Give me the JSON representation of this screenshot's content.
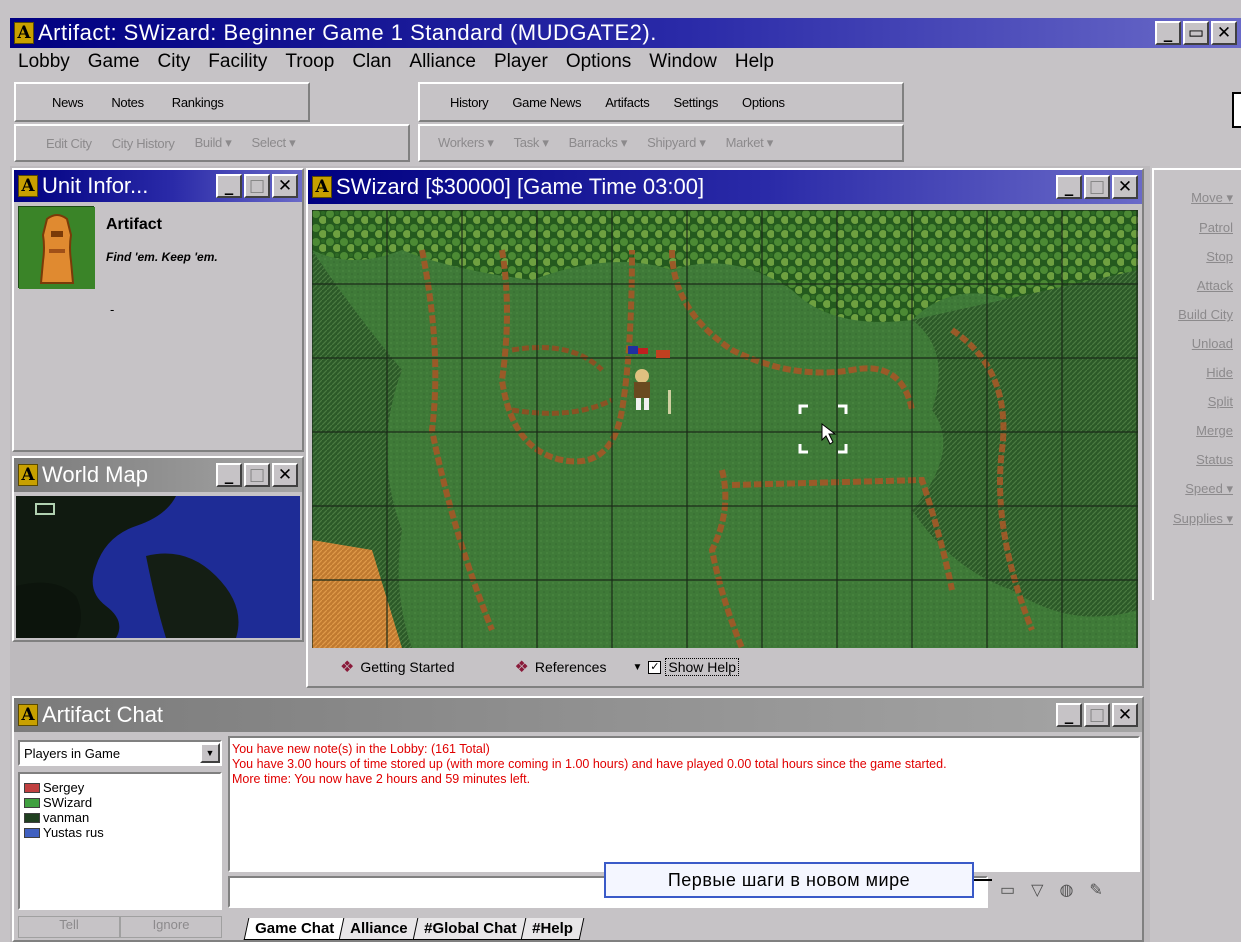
{
  "app": {
    "title": "Artifact: SWizard: Beginner Game 1 Standard (MUDGATE2)."
  },
  "menu": [
    "Lobby",
    "Game",
    "City",
    "Facility",
    "Troop",
    "Clan",
    "Alliance",
    "Player",
    "Options",
    "Window",
    "Help"
  ],
  "toolbar1": {
    "left": [
      "News",
      "Notes",
      "Rankings"
    ],
    "right": [
      "History",
      "Game News",
      "Artifacts",
      "Settings",
      "Options"
    ]
  },
  "toolbar2": {
    "left": [
      "Edit City",
      "City History",
      "Build ▾",
      "Select ▾"
    ],
    "right": [
      "Workers ▾",
      "Task ▾",
      "Barracks ▾",
      "Shipyard ▾",
      "Market ▾"
    ]
  },
  "unit_info": {
    "title": "Unit Infor...",
    "name": "Artifact",
    "tagline": "Find 'em. Keep 'em.",
    "extra": "-"
  },
  "world_map": {
    "title": "World Map"
  },
  "game_window": {
    "title": "SWizard [$30000] [Game Time 03:00]",
    "getting_started": "Getting Started",
    "references": "References",
    "show_help": "Show Help"
  },
  "commands": [
    "Move ▾",
    "Patrol",
    "Stop",
    "Attack",
    "Build City",
    "Unload",
    "Hide",
    "Split",
    "Merge",
    "Status",
    "Speed ▾",
    "Supplies ▾"
  ],
  "chat": {
    "title": "Artifact Chat",
    "players_dropdown": "Players in Game",
    "players": [
      {
        "name": "Sergey",
        "flag": "#c04040"
      },
      {
        "name": "SWizard",
        "flag": "#40a040"
      },
      {
        "name": "vanman",
        "flag": "#204020"
      },
      {
        "name": "Yustas rus",
        "flag": "#4060c0"
      }
    ],
    "tell": "Tell",
    "ignore": "Ignore",
    "messages": [
      "You have new note(s) in the Lobby:  (161 Total)",
      "You have 3.00 hours of time stored up (with more coming in 1.00 hours) and have played 0.00 total hours since the game started.",
      "More time: You now have 2 hours and 59 minutes left."
    ],
    "tabs": [
      "Game Chat",
      "Alliance",
      "#Global Chat",
      "#Help"
    ],
    "caption": "Первые шаги в новом мире"
  },
  "colors": {
    "title_active": "#000080",
    "chat_text": "#e00000",
    "window_bg": "#c6c3c6",
    "terrain": "#3f7a3a"
  }
}
